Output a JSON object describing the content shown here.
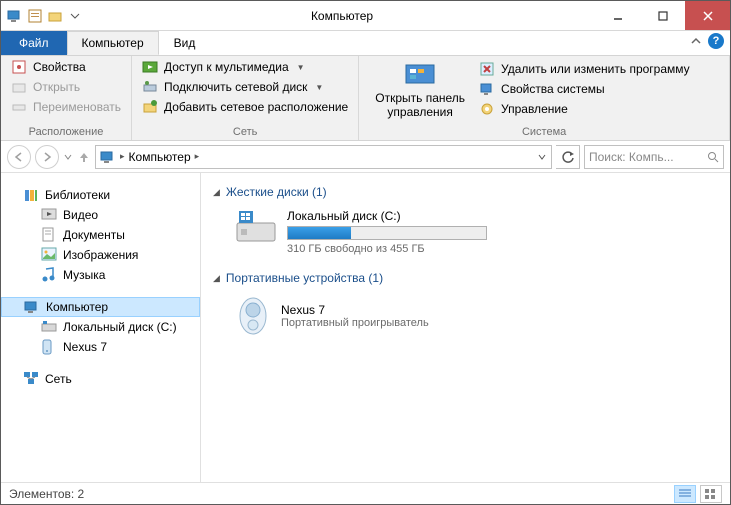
{
  "title": "Компьютер",
  "tabs": {
    "file": "Файл",
    "computer": "Компьютер",
    "view": "Вид"
  },
  "ribbon": {
    "location": {
      "label": "Расположение",
      "properties": "Свойства",
      "open": "Открыть",
      "rename": "Переименовать"
    },
    "network": {
      "label": "Сеть",
      "media": "Доступ к мультимедиа",
      "map_drive": "Подключить сетевой диск",
      "add_location": "Добавить сетевое расположение"
    },
    "system": {
      "label": "Система",
      "open_control_panel_l1": "Открыть панель",
      "open_control_panel_l2": "управления",
      "uninstall": "Удалить или изменить программу",
      "sys_props": "Свойства системы",
      "manage": "Управление"
    }
  },
  "breadcrumb": {
    "root": "Компьютер"
  },
  "search": {
    "placeholder": "Поиск: Компь..."
  },
  "sidebar": {
    "libraries": "Библиотеки",
    "video": "Видео",
    "documents": "Документы",
    "pictures": "Изображения",
    "music": "Музыка",
    "computer": "Компьютер",
    "local_disk": "Локальный диск (C:)",
    "nexus": "Nexus 7",
    "network": "Сеть"
  },
  "content": {
    "hdd_header": "Жесткие диски (1)",
    "local_disk": "Локальный диск (C:)",
    "capacity_text": "310 ГБ свободно из 455 ГБ",
    "capacity_used_pct": 32,
    "portable_header": "Портативные устройства (1)",
    "device_name": "Nexus 7",
    "device_sub": "Портативный проигрыватель"
  },
  "statusbar": {
    "elements": "Элементов: 2"
  }
}
